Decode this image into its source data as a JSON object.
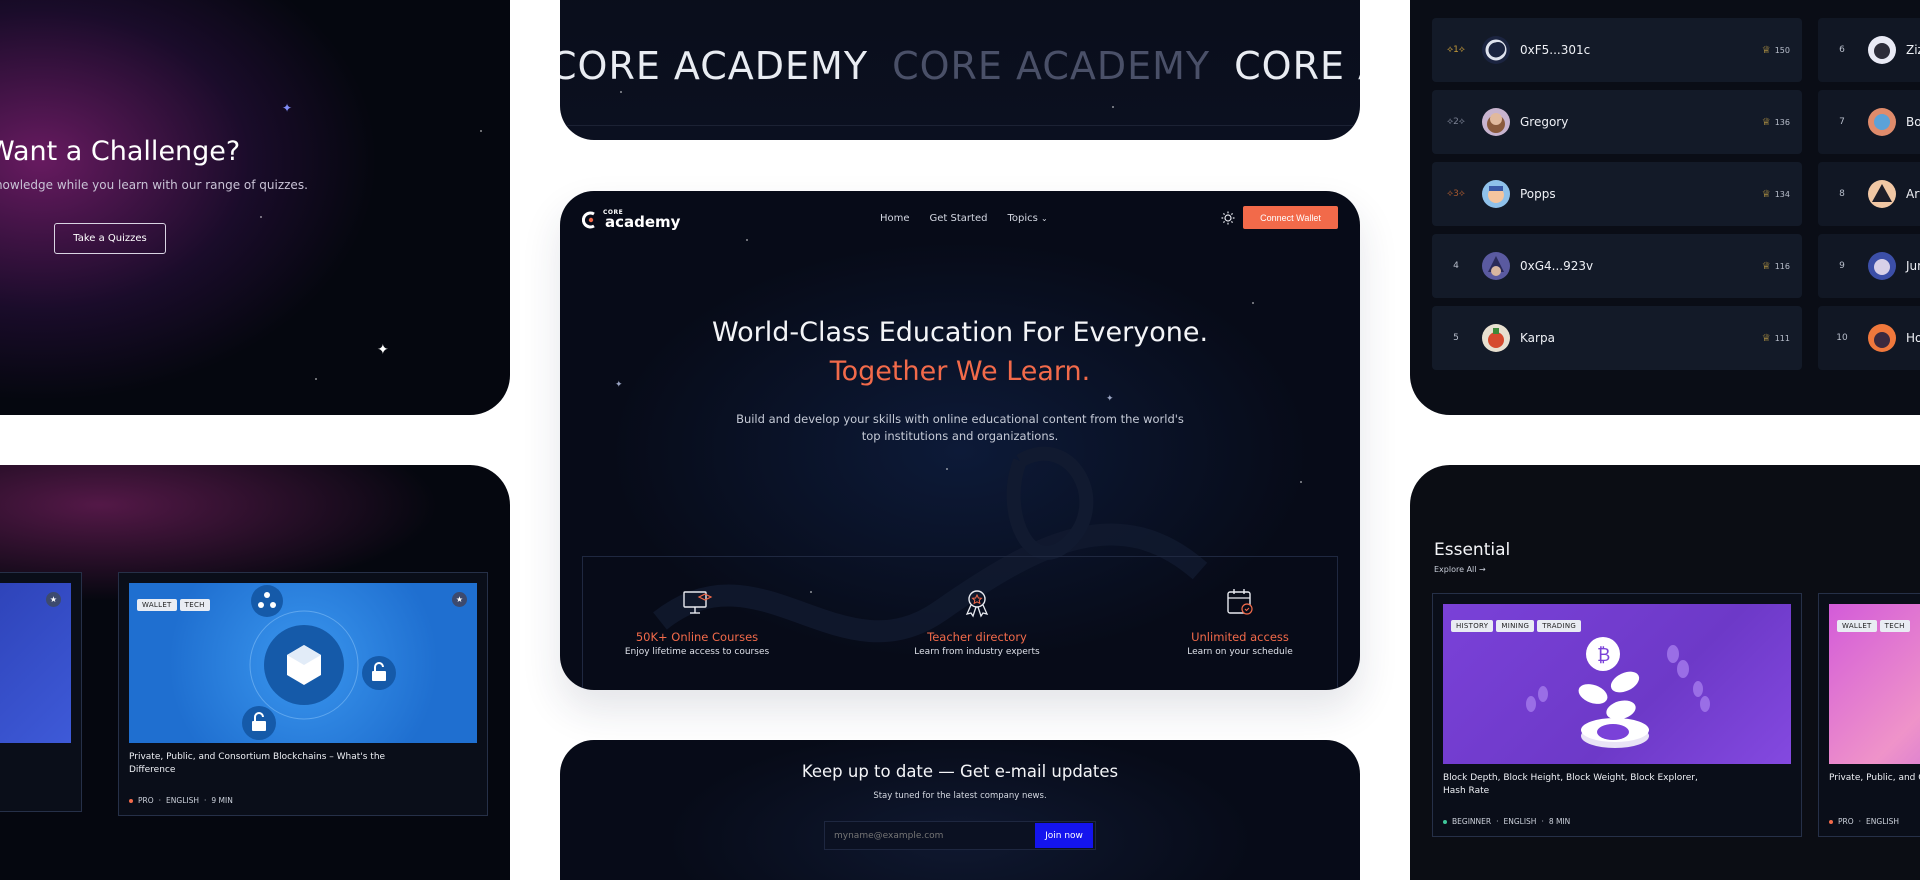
{
  "challenge": {
    "title": "Want a Challenge?",
    "subtitle": "knowledge while you learn with our range of quizzes.",
    "button_label": "Take a Quizzes"
  },
  "marquee": {
    "word_1": "CORE ACADEMY",
    "word_2": "CORE ACADEMY",
    "word_3": "CORE ACADEMY"
  },
  "leaderboard": {
    "rows": [
      {
        "rank": "1",
        "name": "0xF5...301c",
        "score": "150",
        "avatar_color": "#1b2440"
      },
      {
        "rank": "2",
        "name": "Gregory",
        "score": "136",
        "avatar_color": "#b9a9c9"
      },
      {
        "rank": "3",
        "name": "Popps",
        "score": "134",
        "avatar_color": "#8fc1ea"
      },
      {
        "rank": "4",
        "name": "0xG4...923v",
        "score": "116",
        "avatar_color": "#5a5aa0"
      },
      {
        "rank": "5",
        "name": "Karpa",
        "score": "111",
        "avatar_color": "#e8e0d0"
      }
    ],
    "rows_col2": [
      {
        "rank": "6",
        "name": "Zizz",
        "avatar_color": "#e9eaf5"
      },
      {
        "rank": "7",
        "name": "Bon",
        "avatar_color": "#df8b6b"
      },
      {
        "rank": "8",
        "name": "Arv",
        "avatar_color": "#f1c7a4"
      },
      {
        "rank": "9",
        "name": "Jum",
        "avatar_color": "#3c4fa8"
      },
      {
        "rank": "10",
        "name": "Hoc",
        "avatar_color": "#f0783c"
      }
    ]
  },
  "hero": {
    "logo_small": "CORE",
    "logo_main": "academy",
    "nav": [
      "Home",
      "Get Started",
      "Topics"
    ],
    "connect_label": "Connect Wallet",
    "headline": "World-Class Education For Everyone.",
    "headline_accent": "Together We Learn.",
    "description": "Build and develop your skills with online educational content from the world's top institutions and organizations.",
    "features": [
      {
        "title": "50K+ Online Courses",
        "subtitle": "Enjoy lifetime access to courses",
        "icon": "computer-icon"
      },
      {
        "title": "Teacher directory",
        "subtitle": "Learn from industry experts",
        "icon": "award-icon"
      },
      {
        "title": "Unlimited access",
        "subtitle": "Learn on your schedule",
        "icon": "calendar-icon"
      }
    ],
    "accent_color": "#f26a4a"
  },
  "newsletter": {
    "title": "Keep up to date — Get e-mail updates",
    "subtitle": "Stay tuned for the latest company news.",
    "placeholder": "myname@example.com",
    "button_label": "Join now"
  },
  "courses": {
    "card_main": {
      "tags": [
        "WALLET",
        "TECH"
      ],
      "title": "Private, Public, and Consortium Blockchains – What's the Difference",
      "level": "PRO",
      "language": "ENGLISH",
      "duration": "9 MIN"
    }
  },
  "essential": {
    "title": "Essential",
    "explore_label": "Explore All",
    "card_main": {
      "tags": [
        "HISTORY",
        "MINING",
        "TRADING"
      ],
      "title": "Block Depth, Block Height, Block Weight, Block Explorer, Hash Rate",
      "level": "BEGINNER",
      "language": "ENGLISH",
      "duration": "8 MIN"
    },
    "card_side": {
      "tags": [
        "WALLET",
        "TECH"
      ],
      "title": "Private, Public, and C Difference",
      "level": "PRO",
      "language": "ENGLISH"
    }
  }
}
